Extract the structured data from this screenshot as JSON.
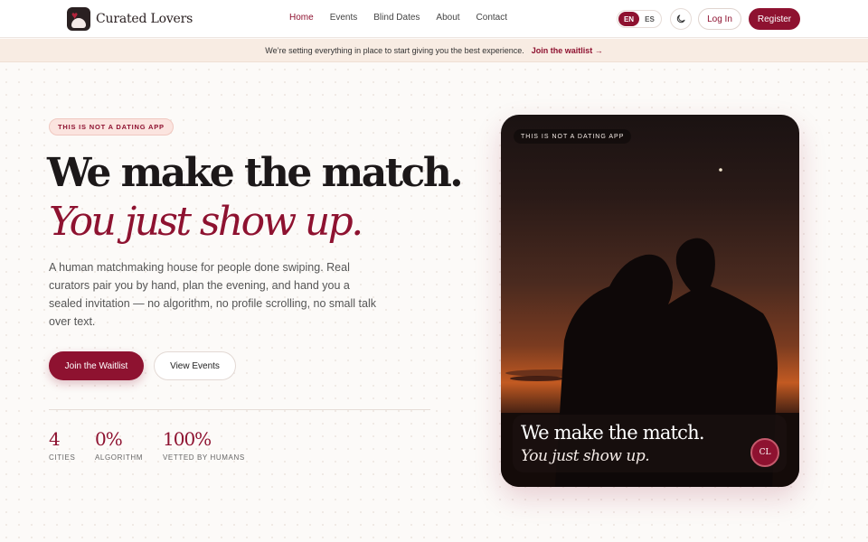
{
  "brand": {
    "name": "Curated Lovers"
  },
  "nav": {
    "items": [
      {
        "label": "Home",
        "active": true
      },
      {
        "label": "Events",
        "active": false
      },
      {
        "label": "Blind Dates",
        "active": false
      },
      {
        "label": "About",
        "active": false
      },
      {
        "label": "Contact",
        "active": false
      }
    ]
  },
  "language": {
    "options": [
      "EN",
      "ES"
    ],
    "selected": "EN"
  },
  "theme_toggle": {
    "icon": "moon-icon"
  },
  "auth": {
    "login_label": "Log In",
    "register_label": "Register"
  },
  "banner": {
    "text": "We’re setting everything in place to start giving you the best experience.",
    "link_label": "Join the waitlist →"
  },
  "hero": {
    "badge": "THIS IS NOT A DATING APP",
    "title": "We make the match.",
    "title_italic": "You just show up.",
    "lede": "A human matchmaking house for people done swiping. Real curators pair you by hand, plan the evening, and hand you a sealed invitation — no algorithm, no profile scrolling, no small talk over text.",
    "primary_cta": "Join the Waitlist",
    "secondary_cta": "View Events",
    "stats": [
      {
        "value": "4",
        "label": "CITIES"
      },
      {
        "value": "0%",
        "label": "ALGORITHM"
      },
      {
        "value": "100%",
        "label": "VETTED BY HUMANS"
      }
    ]
  },
  "card": {
    "tag": "THIS IS NOT A DATING APP",
    "title": "We make the match.",
    "subtitle": "You just show up.",
    "avatar": "CL"
  },
  "colors": {
    "accent": "#8e1230",
    "banner_bg": "#f8ece3",
    "badge_bg": "#fbe4df"
  }
}
